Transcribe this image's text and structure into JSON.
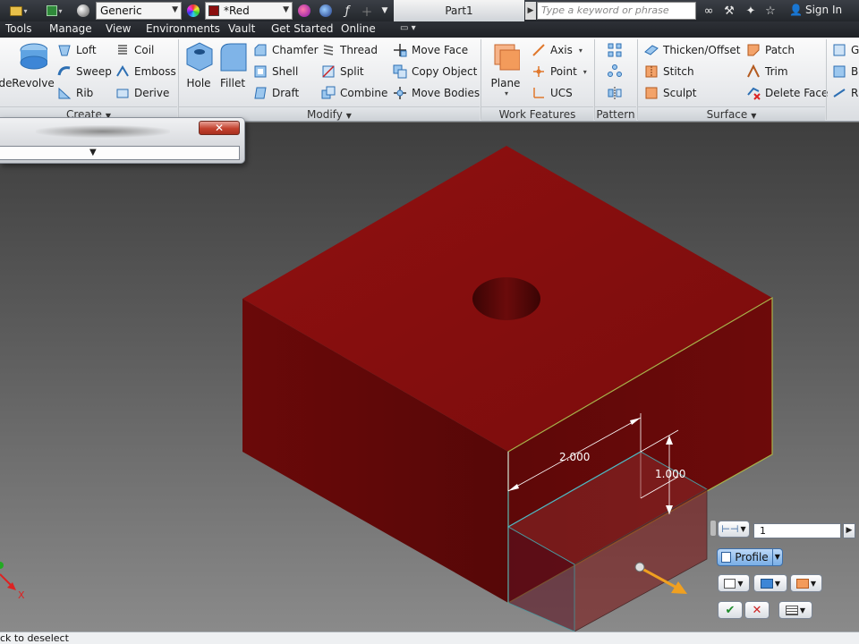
{
  "quick_access": {
    "material": "Generic",
    "appearance": "*Red",
    "document_title": "Part1",
    "search_placeholder": "Type a keyword or phrase",
    "sign_in": "Sign In"
  },
  "menu": {
    "tabs": [
      "Tools",
      "Manage",
      "View",
      "Environments",
      "Vault",
      "Get Started",
      "Online"
    ]
  },
  "ribbon": {
    "create": {
      "title": "Create",
      "extrude_partial": "de",
      "revolve": "Revolve",
      "loft": "Loft",
      "sweep": "Sweep",
      "rib": "Rib",
      "coil": "Coil",
      "emboss": "Emboss",
      "derive": "Derive"
    },
    "modify": {
      "title": "Modify",
      "hole": "Hole",
      "fillet": "Fillet",
      "chamfer": "Chamfer",
      "shell": "Shell",
      "draft": "Draft",
      "thread": "Thread",
      "split": "Split",
      "combine": "Combine",
      "move_face": "Move Face",
      "copy_object": "Copy Object",
      "move_bodies": "Move Bodies"
    },
    "work_features": {
      "title": "Work Features",
      "plane": "Plane",
      "axis": "Axis",
      "point": "Point",
      "ucs": "UCS"
    },
    "pattern": {
      "title": "Pattern"
    },
    "surface": {
      "title": "Surface",
      "thicken_offset": "Thicken/Offset",
      "stitch": "Stitch",
      "sculpt": "Sculpt",
      "patch": "Patch",
      "trim": "Trim",
      "delete_face": "Delete Face"
    },
    "cut_off": {
      "g": "G",
      "b": "B",
      "r": "R"
    }
  },
  "dialog": {
    "close_glyph": "✕"
  },
  "viewport": {
    "dim_width": "2.000",
    "dim_height": "1.000",
    "axis_x": "X",
    "part_color": "#8b0e0e"
  },
  "mini_toolbar": {
    "distance_value": "1",
    "profile_label": "Profile"
  },
  "status": {
    "text": "ck to deselect"
  }
}
